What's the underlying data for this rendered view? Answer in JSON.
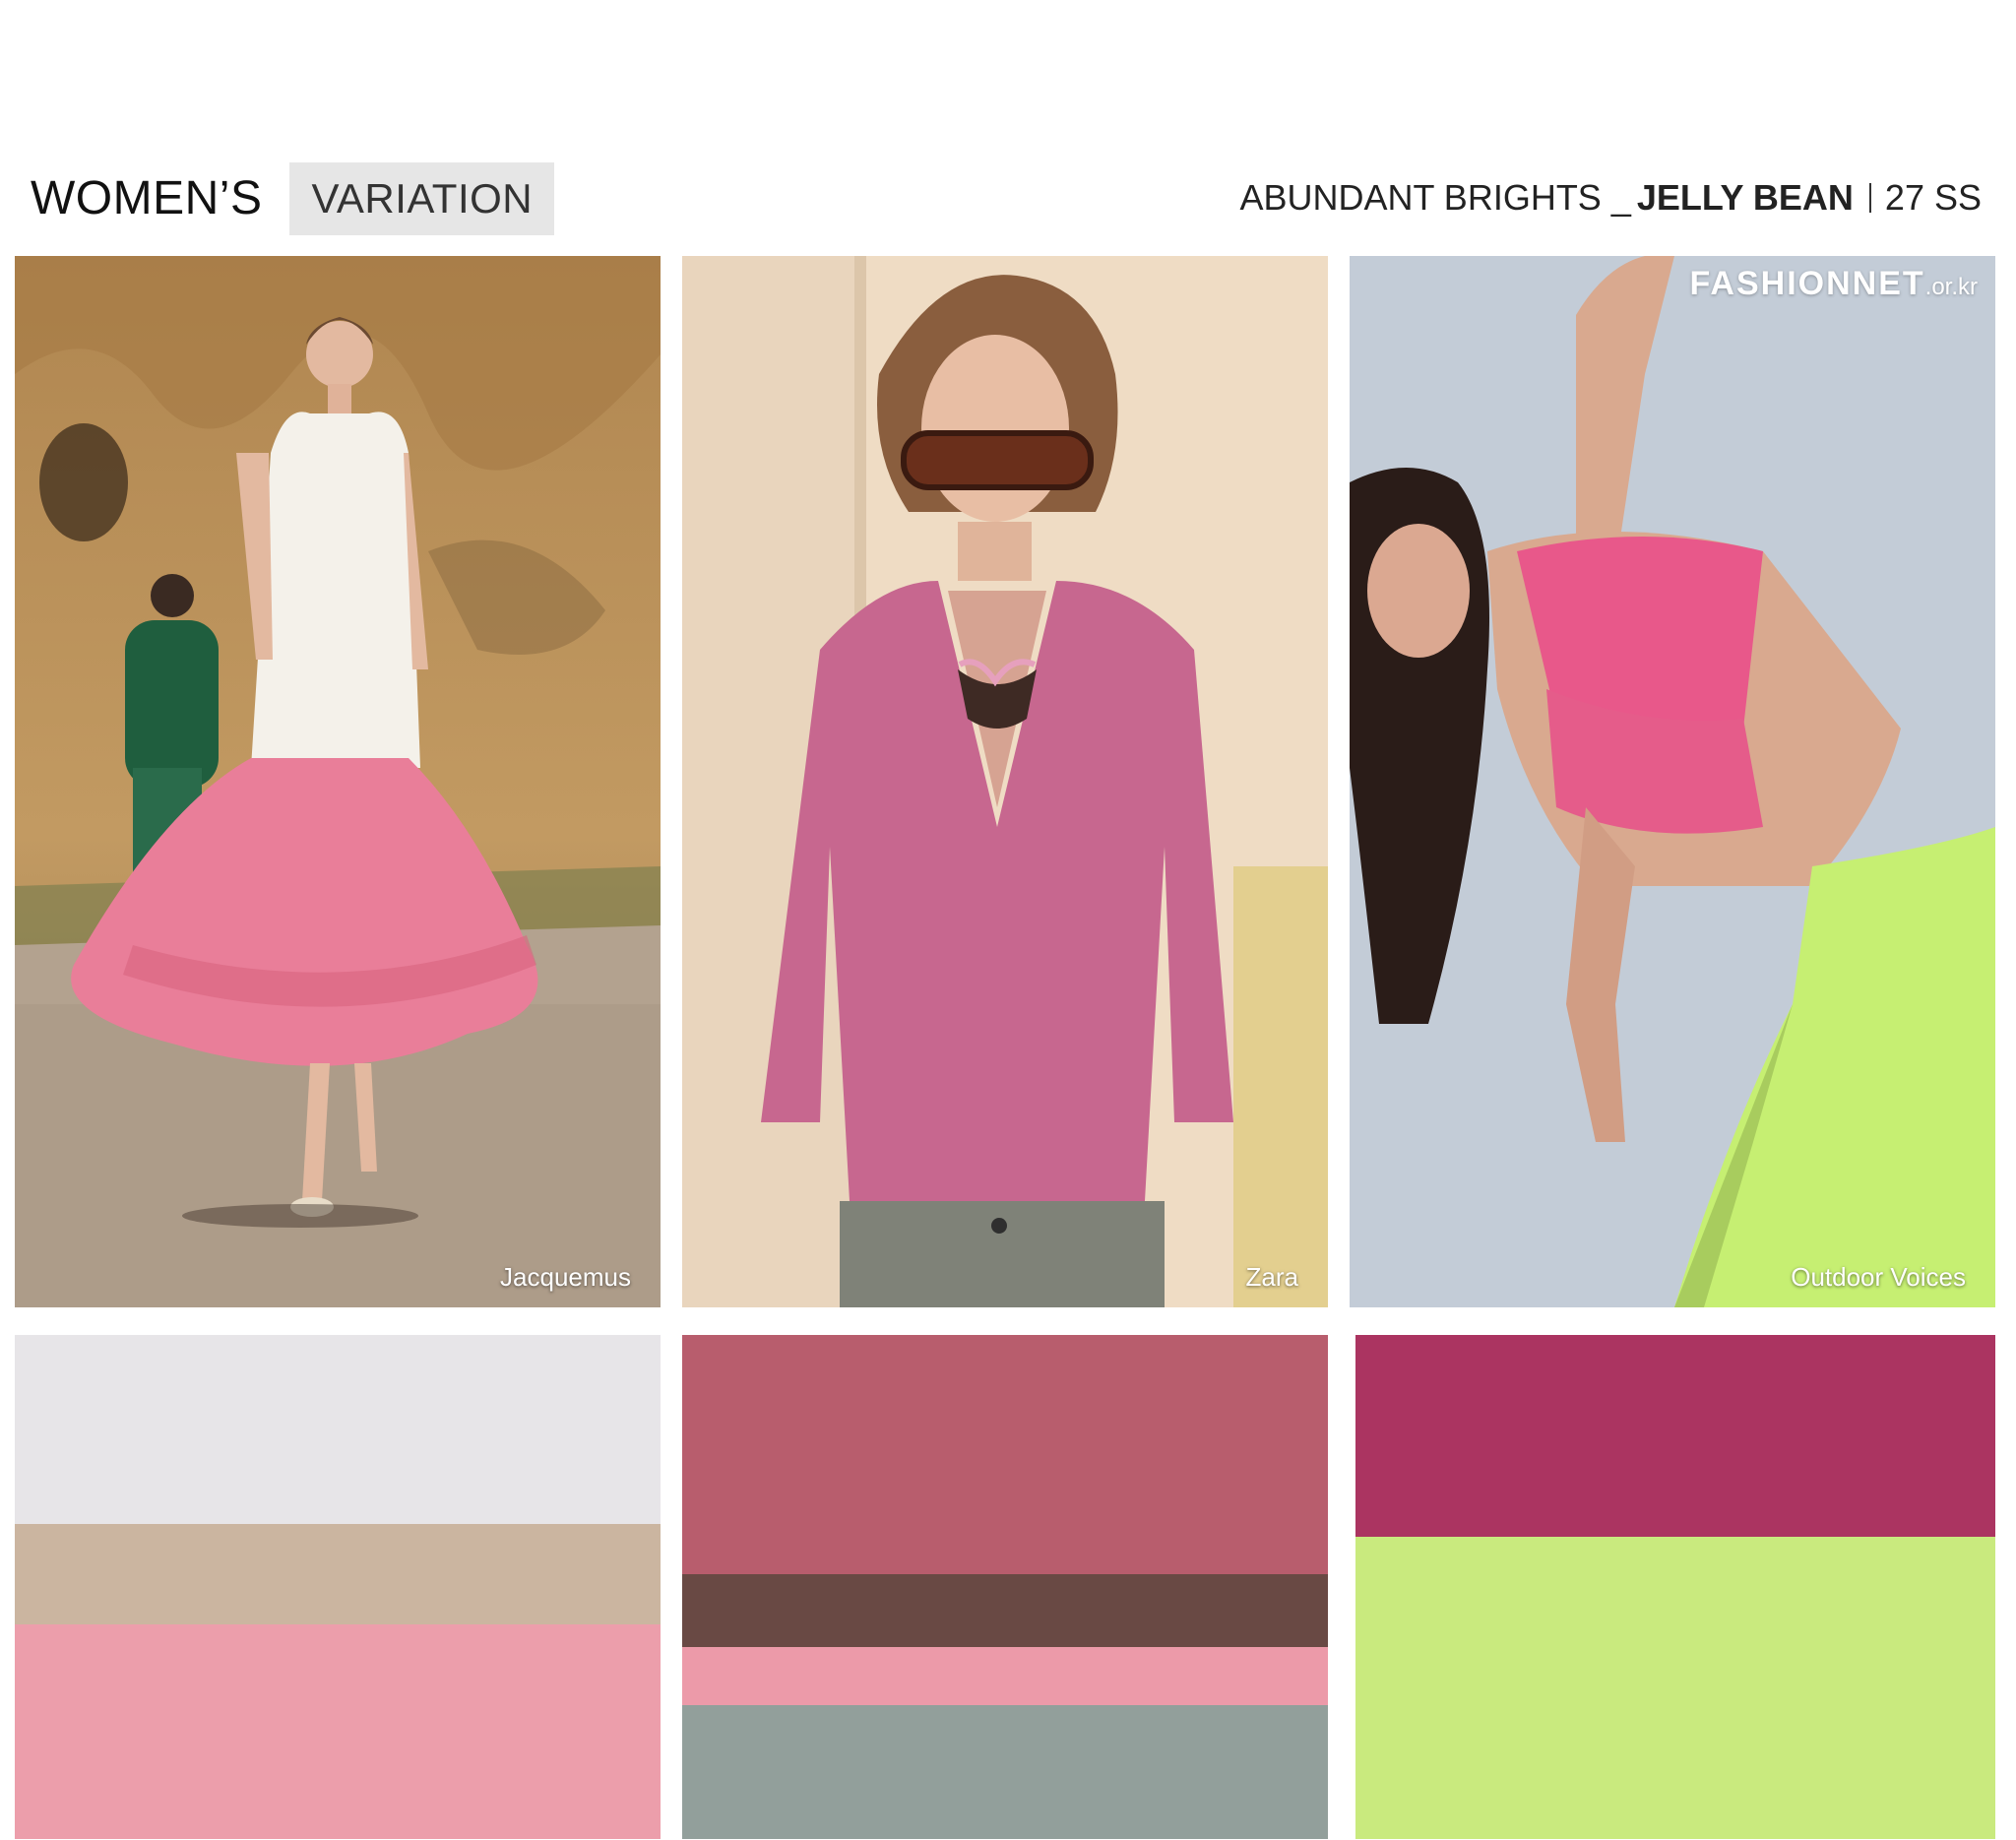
{
  "header": {
    "category": "WOMEN’S",
    "badge": "VARIATION",
    "theme": "ABUNDANT BRIGHTS _",
    "subtheme": "JELLY BEAN",
    "season": "27 SS"
  },
  "photos": [
    {
      "credit": "Jacquemus"
    },
    {
      "credit": "Zara"
    },
    {
      "credit": "Outdoor Voices",
      "logo_main": "FASHIONNET",
      "logo_domain": ".or.kr"
    }
  ],
  "palettes": [
    {
      "swatches": [
        {
          "color": "#e7e5e8",
          "share": 0.375
        },
        {
          "color": "#cbb5a0",
          "share": 0.2
        },
        {
          "color": "#ec9eab",
          "share": 0.425
        }
      ]
    },
    {
      "swatches": [
        {
          "color": "#b85d6d",
          "share": 0.475
        },
        {
          "color": "#694944",
          "share": 0.145
        },
        {
          "color": "#ec9aa9",
          "share": 0.115
        },
        {
          "color": "#929f9b",
          "share": 0.265
        }
      ]
    },
    {
      "swatches": [
        {
          "color": "#ab3461",
          "share": 0.4
        },
        {
          "color": "#c9ea7e",
          "share": 0.6
        }
      ]
    }
  ]
}
